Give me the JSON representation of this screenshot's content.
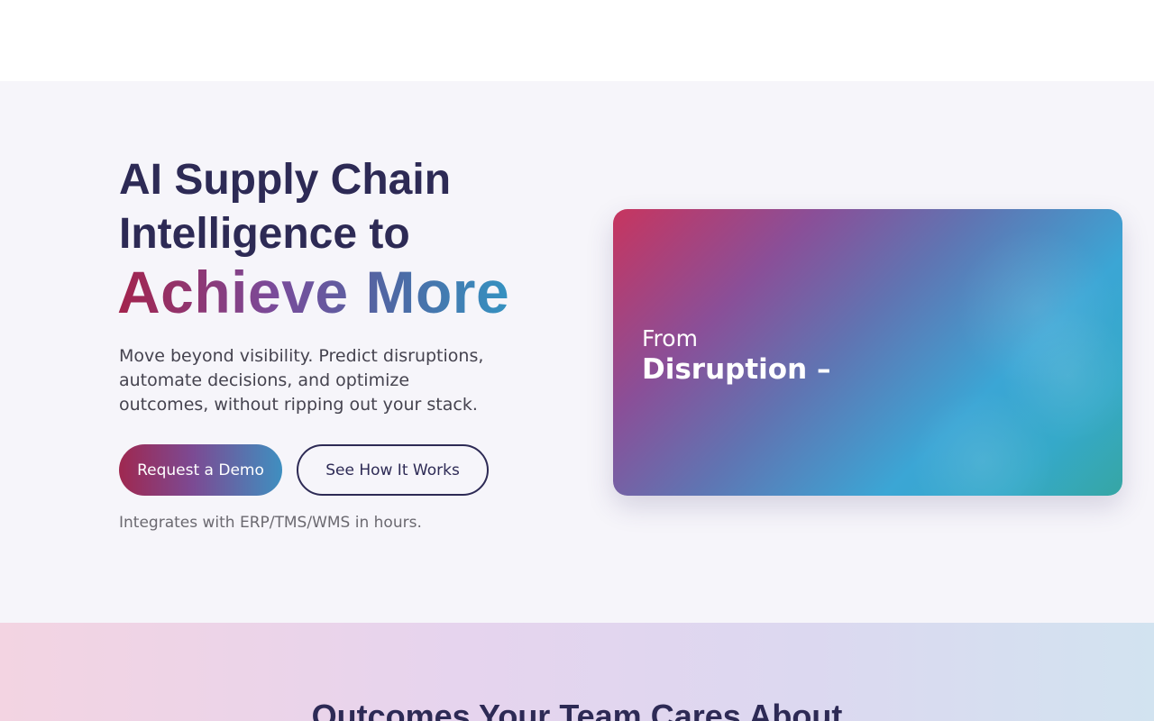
{
  "hero": {
    "title_line1": "AI Supply Chain",
    "title_line2": "Intelligence to",
    "title_accent": "Achieve More",
    "subtitle": "Move beyond visibility. Predict disruptions, automate decisions, and optimize outcomes, without ripping out your stack.",
    "primary_button": "Request a Demo",
    "secondary_button": "See How It Works",
    "note": "Integrates with ERP/TMS/WMS in hours."
  },
  "visual_card": {
    "label_from": "From",
    "headline": "Disruption –"
  },
  "outcomes": {
    "title": "Outcomes Your Team Cares About"
  },
  "colors": {
    "heading": "#2d2a55",
    "hero_bg": "#f6f5fa",
    "accent_start": "#a3234c",
    "accent_end": "#3592c1"
  }
}
